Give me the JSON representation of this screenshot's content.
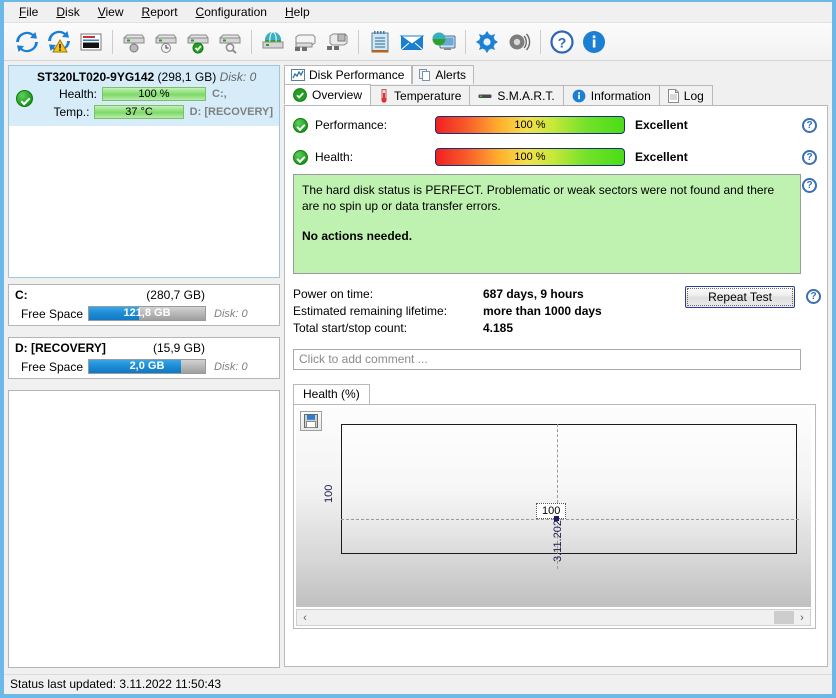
{
  "menu": {
    "items": [
      {
        "pre": "F",
        "key": "i",
        "post": "le",
        "name": "file"
      },
      {
        "pre": "",
        "key": "D",
        "post": "isk",
        "name": "disk"
      },
      {
        "pre": "",
        "key": "V",
        "post": "iew",
        "name": "view"
      },
      {
        "pre": "",
        "key": "R",
        "post": "eport",
        "name": "report"
      },
      {
        "pre": "",
        "key": "C",
        "post": "onfiguration",
        "name": "configuration"
      },
      {
        "pre": "",
        "key": "H",
        "post": "elp",
        "name": "help"
      }
    ]
  },
  "toolbar": {
    "icons": [
      "refresh-icon",
      "refresh-alert-icon",
      "report-icon",
      "disk-scan-icon",
      "disk-clock-icon",
      "disk-check-icon",
      "disk-search-icon",
      "disk-network-icon",
      "disk-usb-icon",
      "disk-usb2-icon",
      "notepad-icon",
      "mail-icon",
      "remote-monitor-icon",
      "gear-icon",
      "sound-icon",
      "help-icon",
      "info-icon"
    ]
  },
  "sidebar": {
    "disk": {
      "model": "ST320LT020-9YG142",
      "capacity": "(298,1 GB)",
      "disk_id": "Disk: 0",
      "health_label": "Health:",
      "health_value": "100 %",
      "temp_label": "Temp.:",
      "temp_value": "37 °C",
      "drive1": "C:,",
      "drive2": "D: [RECOVERY]"
    },
    "volumes": [
      {
        "name": "C:",
        "size": "(280,7 GB)",
        "free_label": "Free Space",
        "free_value": "121,8 GB",
        "free_percent": 43,
        "disk_id": "Disk: 0"
      },
      {
        "name": "D: [RECOVERY]",
        "size": "(15,9 GB)",
        "free_label": "Free Space",
        "free_value": "2,0 GB",
        "free_percent": 79,
        "disk_id": "Disk: 0"
      }
    ]
  },
  "main": {
    "outer_tabs": [
      {
        "label": "Disk Performance",
        "icon": "chart-icon",
        "active": true
      },
      {
        "label": "Alerts",
        "icon": "copy-icon",
        "active": false
      }
    ],
    "inner_tabs": [
      {
        "label": "Overview",
        "icon": "check-circle-icon",
        "active": true
      },
      {
        "label": "Temperature",
        "icon": "thermometer-icon",
        "active": false
      },
      {
        "label": "S.M.A.R.T.",
        "icon": "dash-icon",
        "active": false
      },
      {
        "label": "Information",
        "icon": "info-circle-icon",
        "active": false
      },
      {
        "label": "Log",
        "icon": "document-icon",
        "active": false
      }
    ],
    "status_rows": [
      {
        "label": "Performance:",
        "value": "100 %",
        "rating": "Excellent"
      },
      {
        "label": "Health:",
        "value": "100 %",
        "rating": "Excellent"
      }
    ],
    "message": {
      "text": "The hard disk status is PERFECT. Problematic or weak sectors were not found and there are no spin up or data transfer errors.",
      "emphasis": "No actions needed."
    },
    "stats": [
      {
        "key": "Power on time:",
        "value": "687 days, 9 hours"
      },
      {
        "key": "Estimated remaining lifetime:",
        "value": "more than 1000 days"
      },
      {
        "key": "Total start/stop count:",
        "value": "4.185"
      }
    ],
    "repeat_button": "Repeat Test",
    "comment_placeholder": "Click to add comment ...",
    "help_icon_glyph": "?"
  },
  "chart_data": {
    "type": "line",
    "title": "Health (%)",
    "xlabel": "",
    "ylabel": "100",
    "x": [
      "3.11.2022"
    ],
    "values": [
      100
    ],
    "point_label": "100",
    "ytick_labels": [
      "100"
    ],
    "xtick_labels": [
      "3.11.2022"
    ],
    "ylim": [
      0,
      100
    ],
    "grid": true,
    "legend": "none",
    "save_icon": "floppy-save-icon",
    "scrollbar": {
      "left_arrow": "‹",
      "right_arrow": "›"
    }
  },
  "statusbar": {
    "text": "Status last updated: 3.11.2022 11:50:43"
  }
}
